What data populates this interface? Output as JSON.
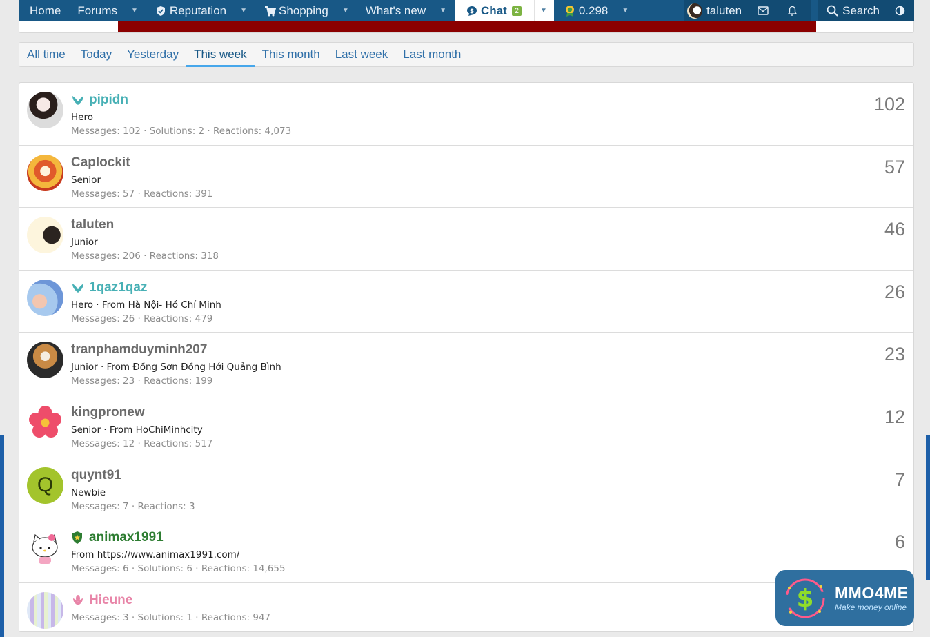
{
  "nav": {
    "items": [
      {
        "label": "Home",
        "caret": false
      },
      {
        "label": "Forums",
        "caret": true
      },
      {
        "label": "Reputation",
        "caret": true,
        "icon": "shield-check-icon"
      },
      {
        "label": "Shopping",
        "caret": true,
        "icon": "cart-icon"
      },
      {
        "label": "What's new",
        "caret": true
      },
      {
        "label": "Chat",
        "badge": "2",
        "caret": true,
        "icon": "chat-dollar-icon",
        "active": true
      },
      {
        "label": "0.298",
        "caret": true,
        "icon": "medal-icon"
      }
    ],
    "user": "taluten",
    "search": "Search"
  },
  "tabs": [
    "All time",
    "Today",
    "Yesterday",
    "This week",
    "This month",
    "Last week",
    "Last month"
  ],
  "active_tab": "This week",
  "members": [
    {
      "name": "pipidn",
      "style": "teal",
      "icon": "wings-icon",
      "title": "Hero",
      "stats": "Messages: 102 · Solutions: 2 · Reactions: 4,073",
      "score": "102",
      "avatar": "photo-girl"
    },
    {
      "name": "Caplockit",
      "style": "",
      "icon": "",
      "title": "Senior",
      "stats": "Messages: 57 · Reactions: 391",
      "score": "57",
      "avatar": "lucky-cat"
    },
    {
      "name": "taluten",
      "style": "",
      "icon": "",
      "title": "Junior",
      "stats": "Messages: 206 · Reactions: 318",
      "score": "46",
      "avatar": "anime-girl"
    },
    {
      "name": "1qaz1qaz",
      "style": "teal",
      "icon": "wings-icon",
      "title": "Hero · From Hà Nội- Hồ Chí Minh",
      "stats": "Messages: 26 · Reactions: 479",
      "score": "26",
      "avatar": "cartoon"
    },
    {
      "name": "tranphamduyminh207",
      "style": "",
      "icon": "",
      "title": "Junior · From Đồng Sơn Đồng Hới Quảng Bình",
      "stats": "Messages: 23 · Reactions: 199",
      "score": "23",
      "avatar": "shiba"
    },
    {
      "name": "kingpronew",
      "style": "",
      "icon": "",
      "title": "Senior · From HoChiMinhcity",
      "stats": "Messages: 12 · Reactions: 517",
      "score": "12",
      "avatar": "flower"
    },
    {
      "name": "quynt91",
      "style": "",
      "icon": "",
      "title": "Newbie",
      "stats": "Messages: 7 · Reactions: 3",
      "score": "7",
      "avatar": "letter",
      "letter": "Q"
    },
    {
      "name": "animax1991",
      "style": "green",
      "icon": "star-shield-icon",
      "title": "From https://www.animax1991.com/",
      "stats": "Messages: 6 · Solutions: 6 · Reactions: 14,655",
      "score": "6",
      "avatar": "kitty"
    },
    {
      "name": "Hieune",
      "style": "pink",
      "icon": "lotus-icon",
      "title": "",
      "stats": "Messages: 3 · Solutions: 1 · Reactions: 947",
      "score": "",
      "avatar": "keyboard"
    }
  ],
  "watermark": {
    "title": "MMO4ME",
    "subtitle": "Make money online"
  }
}
